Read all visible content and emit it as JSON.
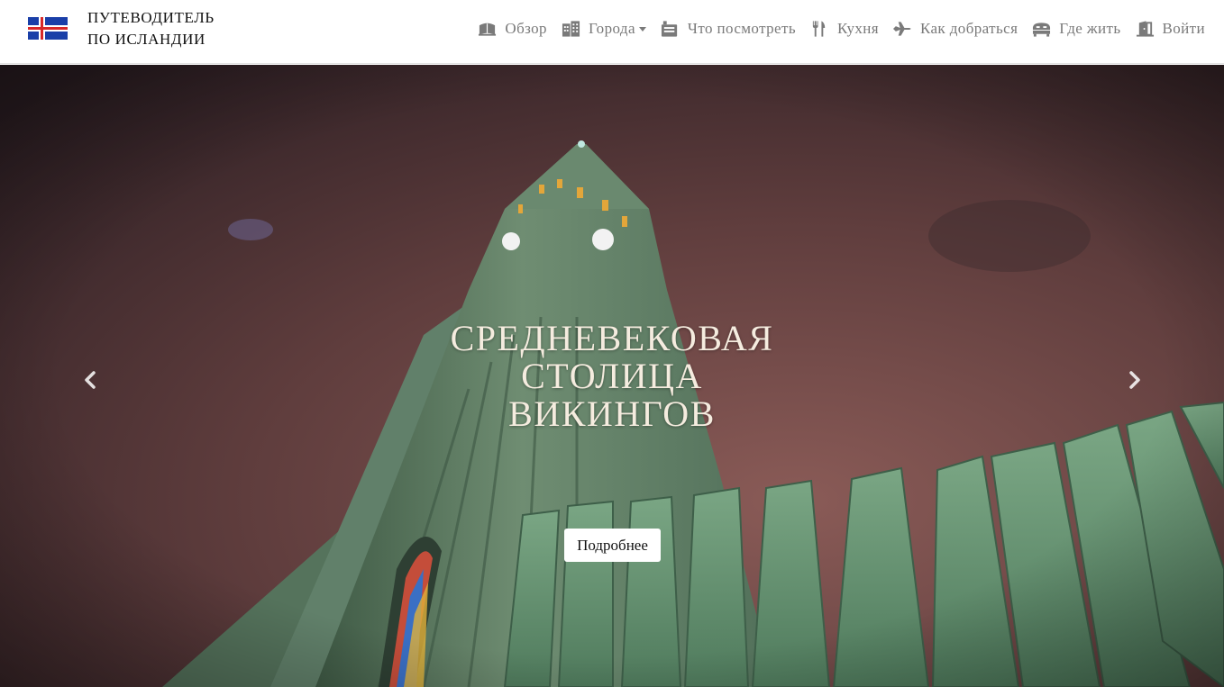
{
  "brand": {
    "line1": "ПУТЕВОДИТЕЛЬ",
    "line2": "ПО ИСЛАНДИИ",
    "flag_icon": "iceland-flag-icon",
    "flag_colors": {
      "field": "#1a3fa8",
      "cross_border": "#ffffff",
      "cross": "#d72828"
    }
  },
  "nav": {
    "items": [
      {
        "label": "Обзор",
        "icon": "book-icon"
      },
      {
        "label": "Города",
        "icon": "city-buildings-icon",
        "dropdown": true
      },
      {
        "label": "Что посмотреть",
        "icon": "camera-icon"
      },
      {
        "label": "Кухня",
        "icon": "fork-knife-icon"
      },
      {
        "label": "Как добраться",
        "icon": "airplane-icon"
      },
      {
        "label": "Где жить",
        "icon": "hotel-bed-icon"
      },
      {
        "label": "Войти",
        "icon": "door-enter-icon"
      }
    ],
    "text_color": "#7a7a7a"
  },
  "hero": {
    "title_lines": [
      "СРЕДНЕВЕКОВАЯ",
      "СТОЛИЦА",
      "ВИКИНГОВ"
    ],
    "button_label": "Подробнее",
    "prev_icon": "chevron-left-icon",
    "next_icon": "chevron-right-icon",
    "image_subject": "church-tower-night-photo",
    "title_color": "#f5ecdf"
  }
}
